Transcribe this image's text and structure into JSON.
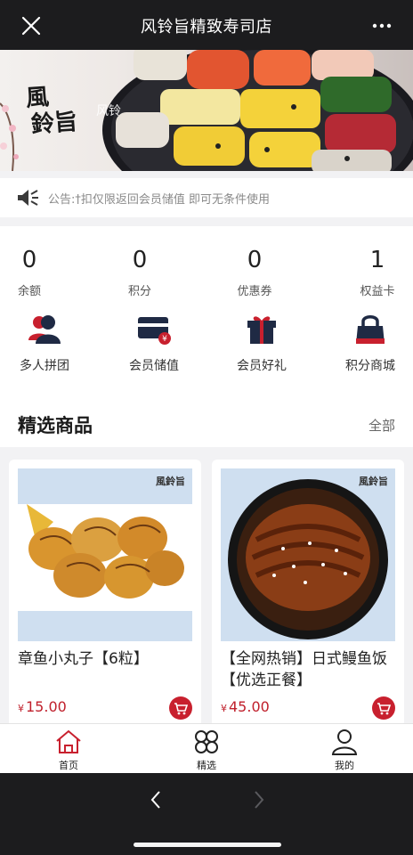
{
  "header": {
    "title": "风铃旨精致寿司店"
  },
  "banner": {
    "logo_line1": "風",
    "logo_line2": "鈴旨",
    "overlay_text": "风铃"
  },
  "notice": {
    "text": "公告:†扣仅限返回会员储值 即可无条件使用"
  },
  "stats": [
    {
      "value": "0",
      "label": "余额"
    },
    {
      "value": "0",
      "label": "积分"
    },
    {
      "value": "0",
      "label": "优惠券"
    },
    {
      "value": "1",
      "label": "权益卡"
    }
  ],
  "services": [
    {
      "label": "多人拼团",
      "icon": "group-icon"
    },
    {
      "label": "会员储值",
      "icon": "card-icon"
    },
    {
      "label": "会员好礼",
      "icon": "gift-icon"
    },
    {
      "label": "积分商城",
      "icon": "bag-icon"
    }
  ],
  "featured": {
    "title": "精选商品",
    "all_label": "全部"
  },
  "products": [
    {
      "name": "章鱼小丸子【6粒】",
      "price_symbol": "¥",
      "price": "15.00",
      "brand": "風鈴旨"
    },
    {
      "name": "【全网热销】日式鳗鱼饭【优选正餐】",
      "price_symbol": "¥",
      "price": "45.00",
      "brand": "風鈴旨"
    }
  ],
  "tabbar": [
    {
      "label": "首页",
      "icon": "home-icon"
    },
    {
      "label": "精选",
      "icon": "grid-icon"
    },
    {
      "label": "我的",
      "icon": "user-icon"
    }
  ],
  "colors": {
    "accent": "#c8202e",
    "navy": "#1f2a44"
  }
}
